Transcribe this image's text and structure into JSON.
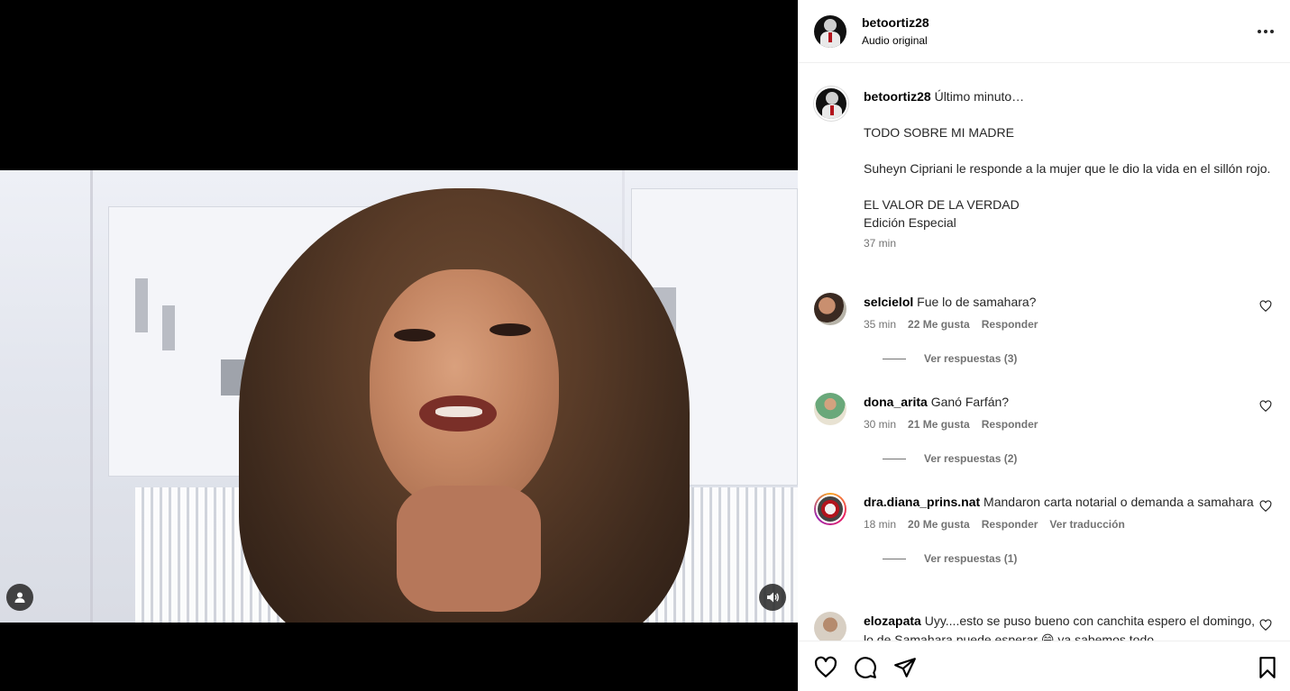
{
  "post": {
    "username": "betoortiz28",
    "audio_label": "Audio original",
    "caption_text": "Último minuto…\n\nTODO SOBRE MI MADRE\n\nSuheyn Cipriani le responde a la mujer que le dio la vida en el sillón rojo.\n\nEL VALOR DE LA VERDAD\nEdición Especial",
    "time": "37 min"
  },
  "comments": [
    {
      "username": "selcielol",
      "text": "Fue lo de samahara?",
      "time": "35 min",
      "likes": "22 Me gusta",
      "reply": "Responder",
      "view_replies": "Ver respuestas (3)"
    },
    {
      "username": "dona_arita",
      "text": "Ganó Farfán?",
      "time": "30 min",
      "likes": "21 Me gusta",
      "reply": "Responder",
      "view_replies": "Ver respuestas (2)"
    },
    {
      "username": "dra.diana_prins.nat",
      "text": "Mandaron carta notarial o demanda a samahara",
      "time": "18 min",
      "likes": "20 Me gusta",
      "reply": "Responder",
      "translate": "Ver traducción",
      "view_replies": "Ver respuestas (1)"
    },
    {
      "username": "elozapata",
      "text": "Uyy....esto se puso bueno con canchita espero el domingo, lo de Samahara puede esperar 😁 ya sabemos todo"
    }
  ],
  "icons": {
    "more": "more-options-icon",
    "like": "heart-icon",
    "comment": "comment-icon",
    "share": "share-icon",
    "save": "bookmark-icon",
    "user_tag": "user-tag-icon",
    "volume": "volume-icon"
  }
}
